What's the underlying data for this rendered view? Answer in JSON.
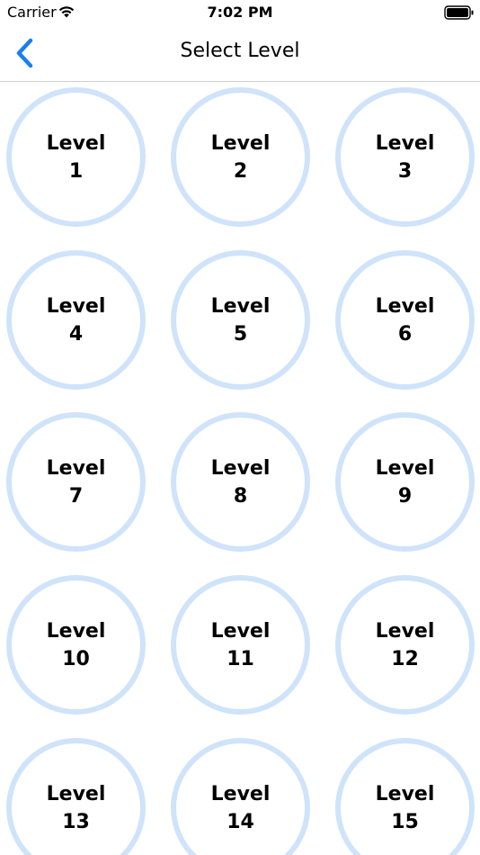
{
  "status_bar": {
    "carrier": "Carrier",
    "time": "7:02 PM"
  },
  "nav": {
    "title": "Select Level",
    "accent_color": "#1a7ff0"
  },
  "levels": [
    {
      "word": "Level",
      "number": "1"
    },
    {
      "word": "Level",
      "number": "2"
    },
    {
      "word": "Level",
      "number": "3"
    },
    {
      "word": "Level",
      "number": "4"
    },
    {
      "word": "Level",
      "number": "5"
    },
    {
      "word": "Level",
      "number": "6"
    },
    {
      "word": "Level",
      "number": "7"
    },
    {
      "word": "Level",
      "number": "8"
    },
    {
      "word": "Level",
      "number": "9"
    },
    {
      "word": "Level",
      "number": "10"
    },
    {
      "word": "Level",
      "number": "11"
    },
    {
      "word": "Level",
      "number": "12"
    },
    {
      "word": "Level",
      "number": "13"
    },
    {
      "word": "Level",
      "number": "14"
    },
    {
      "word": "Level",
      "number": "15"
    }
  ],
  "colors": {
    "circle_border": "#cfe3fa",
    "divider": "#cfcfd3"
  }
}
